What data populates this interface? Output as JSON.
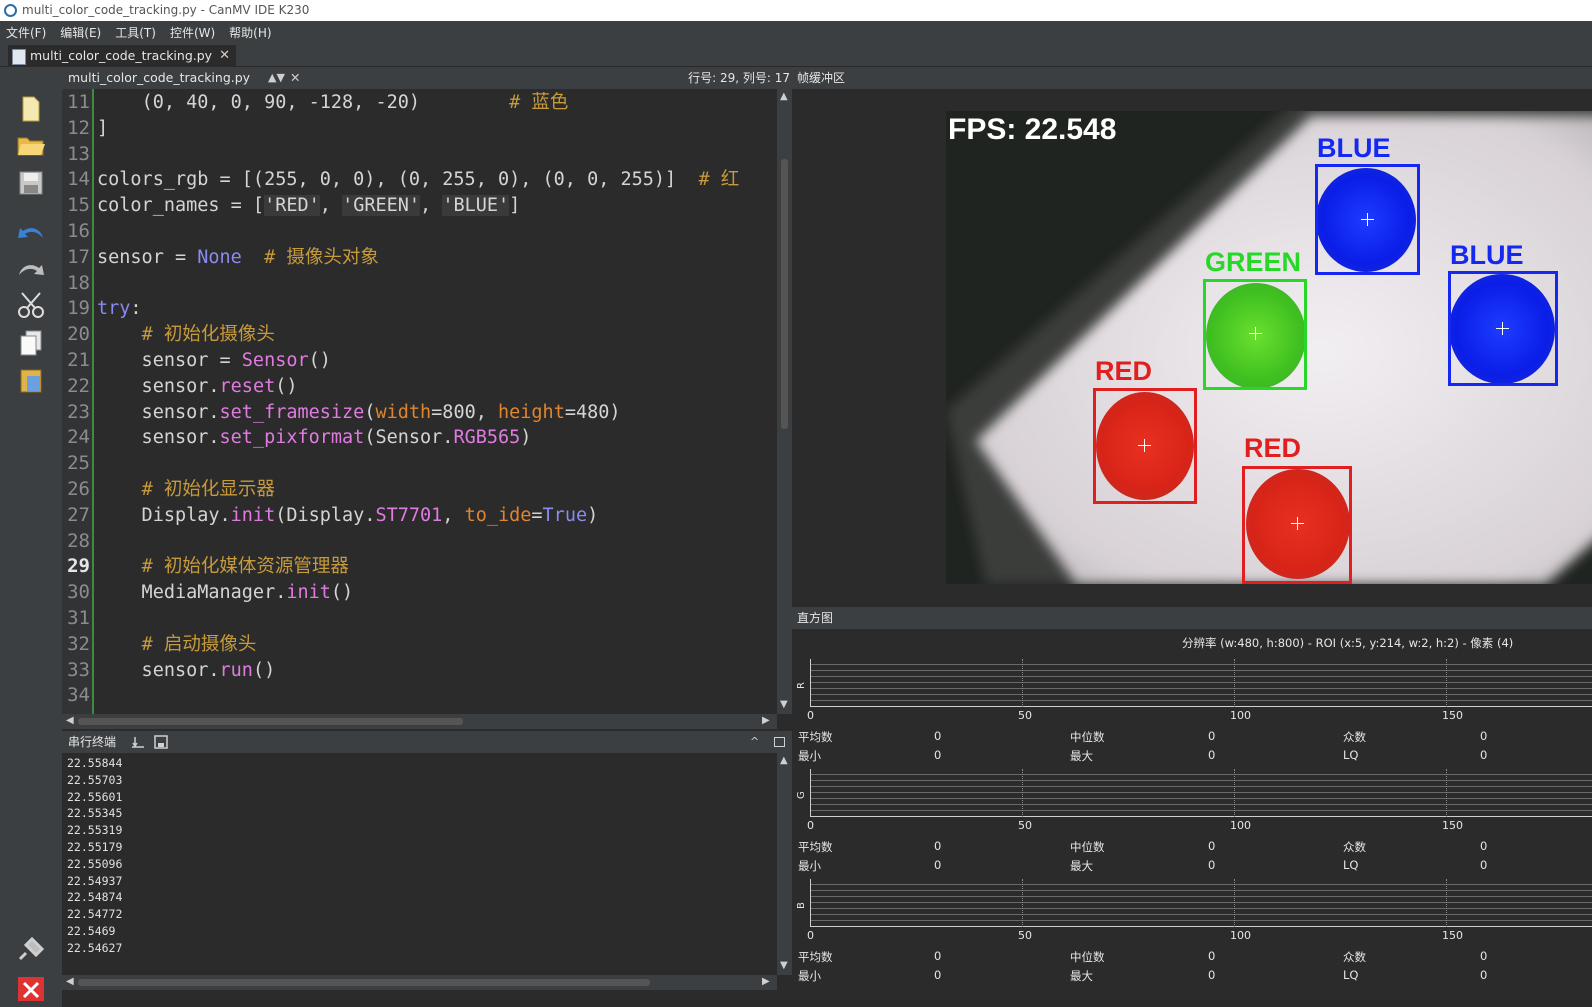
{
  "window": {
    "title": "multi_color_code_tracking.py - CanMV IDE K230"
  },
  "menu": [
    "文件(F)",
    "编辑(E)",
    "工具(T)",
    "控件(W)",
    "帮助(H)"
  ],
  "file_tab": {
    "label": "multi_color_code_tracking.py",
    "close": "✕"
  },
  "editor": {
    "filename": "multi_color_code_tracking.py",
    "position": "行号: 29, 列号: 17",
    "current_line": 29,
    "lines": [
      {
        "n": "11",
        "html": "    <span style='color:#d4d4d4'>(</span><span style='color:#d4d4d4'>0, 40, 0, 90, -128, -20)</span>        <span style='color:#c79a3b'># 蓝色</span>"
      },
      {
        "n": "12",
        "html": "]"
      },
      {
        "n": "13",
        "html": ""
      },
      {
        "n": "14",
        "html": "colors_rgb = [(255, 0, 0), (0, 255, 0), (0, 0, 255)]  <span style='color:#c79a3b'># 红</span>"
      },
      {
        "n": "15",
        "html": "color_names = [<span style='background:#3a3a3a;color:#d4d4d4'>'RED'</span>, <span style='background:#3a3a3a;color:#d4d4d4'>'GREEN'</span>, <span style='background:#3a3a3a;color:#d4d4d4'>'BLUE'</span>]"
      },
      {
        "n": "16",
        "html": ""
      },
      {
        "n": "17",
        "html": "sensor = <span style='color:#8a8af0'>None</span>  <span style='color:#c79a3b'># 摄像头对象</span>"
      },
      {
        "n": "18",
        "html": ""
      },
      {
        "n": "19",
        "html": "<span style='color:#8a8af0'>try</span>:"
      },
      {
        "n": "20",
        "html": "    <span style='color:#c79a3b'># 初始化摄像头</span>"
      },
      {
        "n": "21",
        "html": "    sensor = <span style='color:#e07be0'>Sensor</span>()"
      },
      {
        "n": "22",
        "html": "    sensor.<span style='color:#e07be0'>reset</span>()"
      },
      {
        "n": "23",
        "html": "    sensor.<span style='color:#e07be0'>set_framesize</span>(<span style='color:#e0852c'>width</span>=800, <span style='color:#e0852c'>height</span>=480)"
      },
      {
        "n": "24",
        "html": "    sensor.<span style='color:#e07be0'>set_pixformat</span>(Sensor.<span style='color:#e07be0'>RGB565</span>)"
      },
      {
        "n": "25",
        "html": ""
      },
      {
        "n": "26",
        "html": "    <span style='color:#c79a3b'># 初始化显示器</span>"
      },
      {
        "n": "27",
        "html": "    Display.<span style='color:#e07be0'>init</span>(Display.<span style='color:#e07be0'>ST7701</span>, <span style='color:#e0852c'>to_ide</span>=<span style='color:#8a8af0'>True</span>)"
      },
      {
        "n": "28",
        "html": ""
      },
      {
        "n": "29",
        "html": "    <span style='color:#c79a3b'># 初始化媒体资源管理器</span>"
      },
      {
        "n": "30",
        "html": "    MediaManager.<span style='color:#e07be0'>init</span>()"
      },
      {
        "n": "31",
        "html": ""
      },
      {
        "n": "32",
        "html": "    <span style='color:#c79a3b'># 启动摄像头</span>"
      },
      {
        "n": "33",
        "html": "    sensor.<span style='color:#e07be0'>run</span>()"
      },
      {
        "n": "34",
        "html": ""
      }
    ]
  },
  "terminal": {
    "title": "串行终端",
    "lines": [
      "22.55844",
      "22.55703",
      "22.55601",
      "22.55345",
      "22.55319",
      "22.55179",
      "22.55096",
      "22.54937",
      "22.54874",
      "22.54772",
      "22.5469",
      "22.54627"
    ]
  },
  "framebuffer": {
    "title": "帧缓冲区",
    "fps_text": "FPS: 22.548",
    "blobs": [
      {
        "label": "BLUE",
        "color": "#1428f0"
      },
      {
        "label": "GREEN",
        "color": "#28d828"
      },
      {
        "label": "BLUE",
        "color": "#1428f0"
      },
      {
        "label": "RED",
        "color": "#e02020"
      },
      {
        "label": "RED",
        "color": "#e02020"
      }
    ]
  },
  "histogram": {
    "title": "直方图",
    "info": "分辨率 (w:480, h:800) - ROI (x:5, y:214, w:2, h:2) - 像素 (4)",
    "ticks": [
      "0",
      "50",
      "100",
      "150"
    ],
    "channels": [
      {
        "name": "R",
        "mean_label": "平均数",
        "mean": "0",
        "median_label": "中位数",
        "median": "0",
        "mode_label": "众数",
        "mode": "0",
        "min_label": "最小",
        "min": "0",
        "max_label": "最大",
        "max": "0",
        "lq_label": "LQ",
        "lq": "0"
      },
      {
        "name": "G",
        "mean_label": "平均数",
        "mean": "0",
        "median_label": "中位数",
        "median": "0",
        "mode_label": "众数",
        "mode": "0",
        "min_label": "最小",
        "min": "0",
        "max_label": "最大",
        "max": "0",
        "lq_label": "LQ",
        "lq": "0"
      },
      {
        "name": "B",
        "mean_label": "平均数",
        "mean": "0",
        "median_label": "中位数",
        "median": "0",
        "mode_label": "众数",
        "mode": "0",
        "min_label": "最小",
        "min": "0",
        "max_label": "最大",
        "max": "0",
        "lq_label": "LQ",
        "lq": "0"
      }
    ]
  }
}
